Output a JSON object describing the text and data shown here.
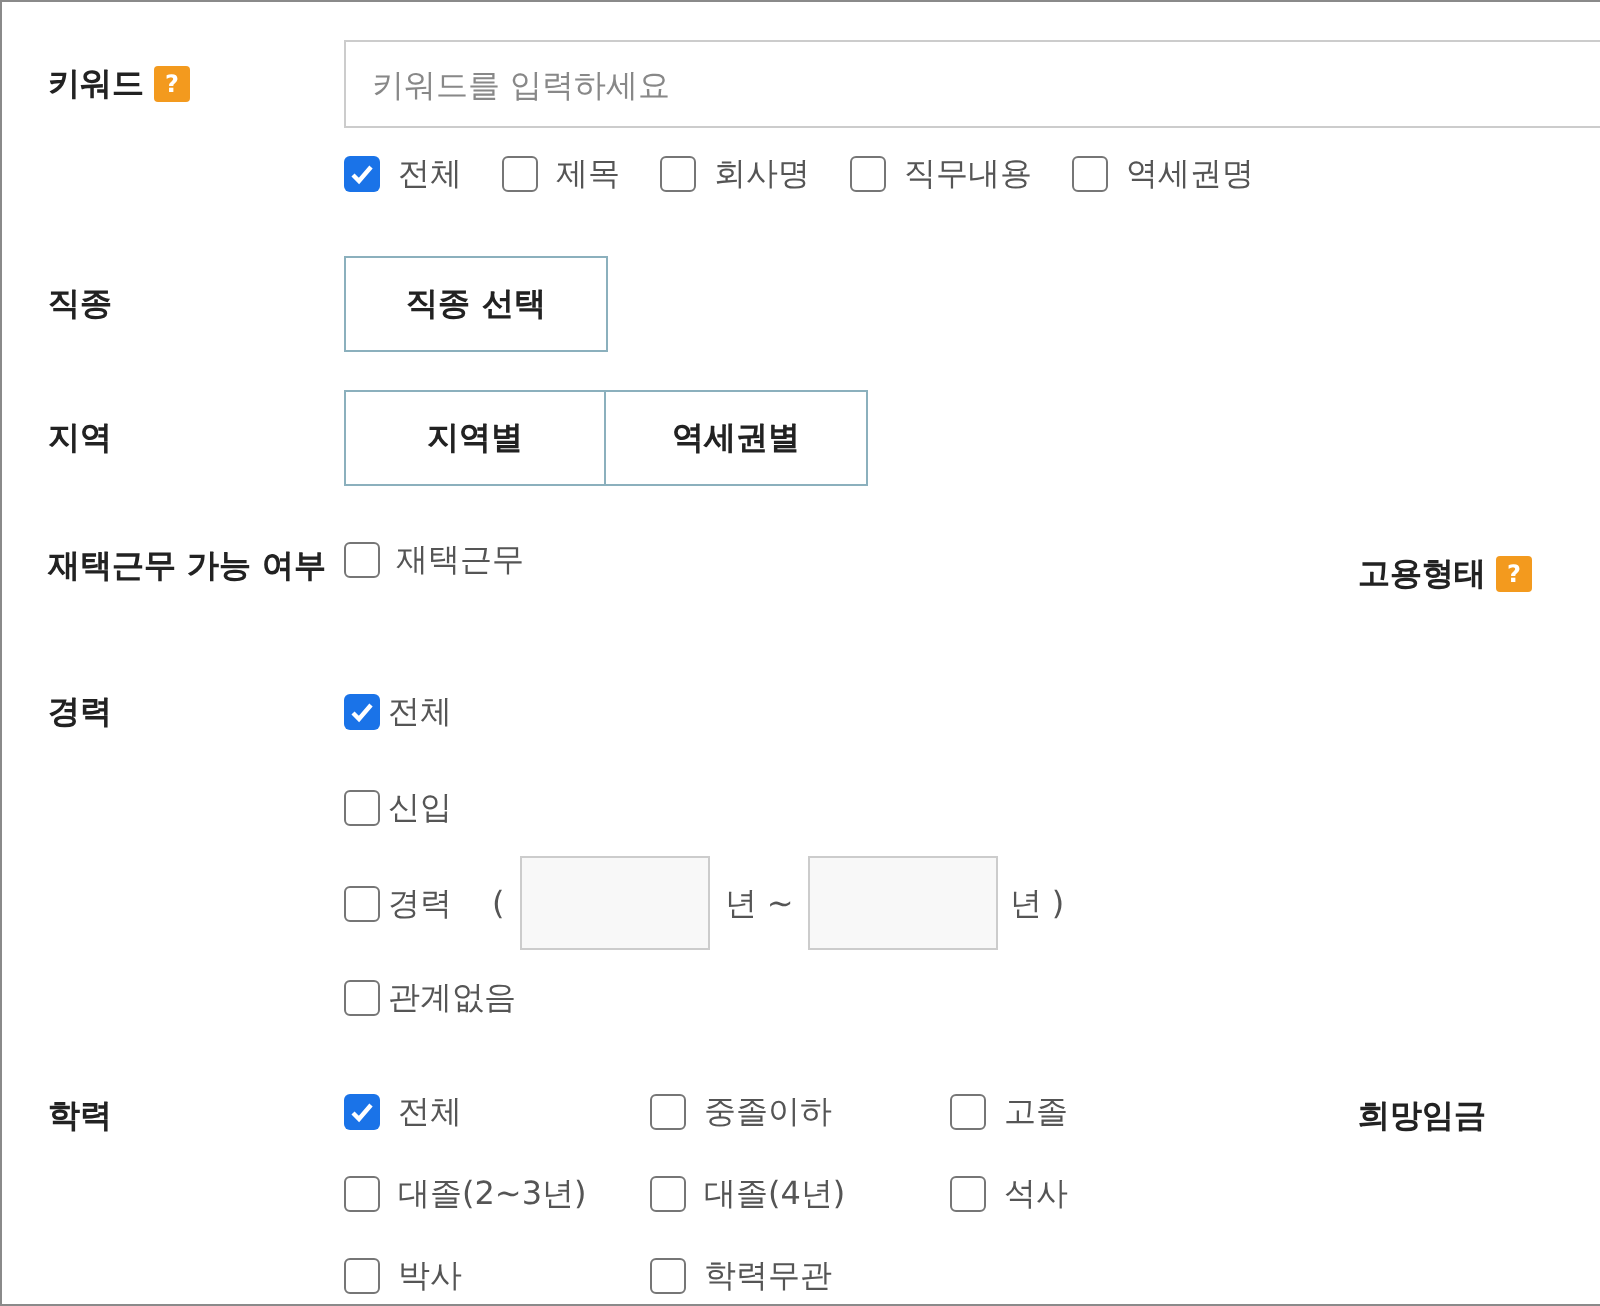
{
  "keyword": {
    "label": "키워드",
    "help": "?",
    "placeholder": "키워드를 입력하세요",
    "options": [
      {
        "label": "전체",
        "checked": true
      },
      {
        "label": "제목",
        "checked": false
      },
      {
        "label": "회사명",
        "checked": false
      },
      {
        "label": "직무내용",
        "checked": false
      },
      {
        "label": "역세권명",
        "checked": false
      }
    ]
  },
  "job_type": {
    "label": "직종",
    "button": "직종 선택"
  },
  "region": {
    "label": "지역",
    "buttons": [
      "지역별",
      "역세권별"
    ]
  },
  "remote": {
    "label": "재택근무 가능 여부",
    "option": {
      "label": "재택근무",
      "checked": false
    }
  },
  "employment_type": {
    "label": "고용형태",
    "help": "?"
  },
  "career": {
    "label": "경력",
    "options": [
      {
        "kind": "checkbox",
        "label": "전체",
        "checked": true
      },
      {
        "kind": "checkbox",
        "label": "신입",
        "checked": false
      },
      {
        "kind": "range",
        "label": "경력",
        "checked": false,
        "open": "(",
        "middle": "년 ~",
        "close": "년 )"
      },
      {
        "kind": "checkbox",
        "label": "관계없음",
        "checked": false
      }
    ]
  },
  "education": {
    "label": "학력",
    "options": [
      {
        "label": "전체",
        "checked": true
      },
      {
        "label": "중졸이하",
        "checked": false
      },
      {
        "label": "고졸",
        "checked": false
      },
      {
        "label": "대졸(2~3년)",
        "checked": false
      },
      {
        "label": "대졸(4년)",
        "checked": false
      },
      {
        "label": "석사",
        "checked": false
      },
      {
        "label": "박사",
        "checked": false
      },
      {
        "label": "학력무관",
        "checked": false
      }
    ]
  },
  "desired_salary": {
    "label": "희망임금"
  }
}
